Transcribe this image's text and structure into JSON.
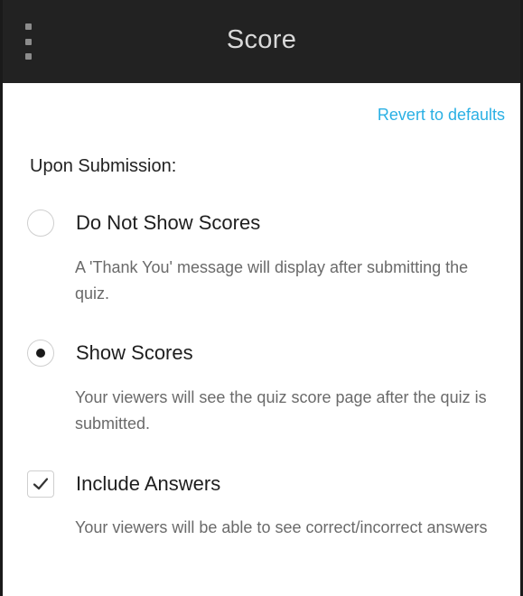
{
  "header": {
    "menu_icon": "kebab-menu-icon",
    "title": "Score"
  },
  "revert_link": "Revert to defaults",
  "section_label": "Upon Submission:",
  "options": {
    "do_not_show": {
      "label": "Do Not Show Scores",
      "description": "A 'Thank You' message will display after submitting the quiz.",
      "selected": false
    },
    "show_scores": {
      "label": "Show Scores",
      "description": "Your viewers will see the quiz score page after the quiz is submitted.",
      "selected": true
    },
    "include_answers": {
      "label": "Include Answers",
      "description": "Your viewers will be able to see correct/incorrect answers",
      "checked": true
    }
  },
  "colors": {
    "header_bg": "#222222",
    "link": "#2ab0e4",
    "selected_dot": "#1a1a1a"
  }
}
